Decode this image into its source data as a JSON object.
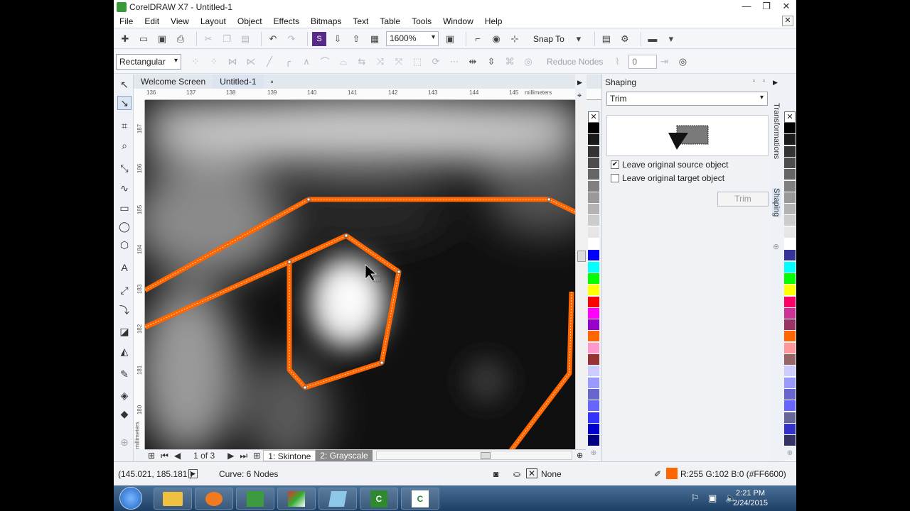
{
  "window": {
    "title": "CorelDRAW X7 - Untitled-1",
    "minimize": "—",
    "restore": "❐",
    "close": "✕"
  },
  "menu": [
    "File",
    "Edit",
    "View",
    "Layout",
    "Object",
    "Effects",
    "Bitmaps",
    "Text",
    "Table",
    "Tools",
    "Window",
    "Help"
  ],
  "menu_close": "✕",
  "toolbar": {
    "zoom": "1600%",
    "snap_to": "Snap To"
  },
  "property_bar": {
    "selection_mode": "Rectangular",
    "reduce_nodes": "Reduce Nodes",
    "node_value": "0"
  },
  "doc_tabs": [
    "Welcome Screen",
    "Untitled-1"
  ],
  "ruler_h": {
    "labels": [
      "136",
      "137",
      "138",
      "139",
      "140",
      "141",
      "142",
      "143",
      "144",
      "145"
    ],
    "unit": "millimeters"
  },
  "ruler_v": {
    "labels": [
      "187",
      "186",
      "185",
      "184",
      "183",
      "182",
      "181",
      "180"
    ],
    "unit": "millimeters"
  },
  "page_nav": {
    "label": "1 of 3",
    "tabs": [
      "1: Skintone",
      "2: Grayscale"
    ]
  },
  "docker": {
    "title": "Shaping",
    "mode": "Trim",
    "options": [
      {
        "label": "Leave original source object",
        "checked": true
      },
      {
        "label": "Leave original target object",
        "checked": false
      }
    ],
    "apply_button": "Trim"
  },
  "side_tabs": [
    "Transformations",
    "Shaping"
  ],
  "status": {
    "coords": "(145.021, 185.181 )",
    "object_info": "Curve: 6 Nodes",
    "fill_label": "None",
    "outline_color": "R:255 G:102 B:0 (#FF6600)"
  },
  "colors": {
    "accent_orange": "#FF6600"
  },
  "palette1": [
    "#000000",
    "#1a1a1a",
    "#333333",
    "#4d4d4d",
    "#666666",
    "#808080",
    "#999999",
    "#b3b3b3",
    "#cccccc",
    "#e6e6e6",
    "#ffffff",
    "#0000ff",
    "#00ffff",
    "#00ff00",
    "#ffff00",
    "#ff0000",
    "#ff00ff",
    "#9900cc",
    "#ff6600",
    "#ff99cc",
    "#993333",
    "#ccccff",
    "#9999ff",
    "#6666cc",
    "#6666ff",
    "#3333ff",
    "#0000cc",
    "#000080"
  ],
  "palette2": [
    "#000000",
    "#1a1a1a",
    "#333333",
    "#4d4d4d",
    "#666666",
    "#808080",
    "#999999",
    "#b3b3b3",
    "#cccccc",
    "#e6e6e6",
    "#ffffff",
    "#333399",
    "#00ffff",
    "#00ff00",
    "#ffff00",
    "#ff0066",
    "#cc3399",
    "#993366",
    "#ff6600",
    "#ff9999",
    "#996666",
    "#ccccff",
    "#9999ff",
    "#6666cc",
    "#6666ff",
    "#666699",
    "#3333cc",
    "#333366"
  ],
  "taskbar": {
    "time": "2:21 PM",
    "date": "2/24/2015"
  }
}
